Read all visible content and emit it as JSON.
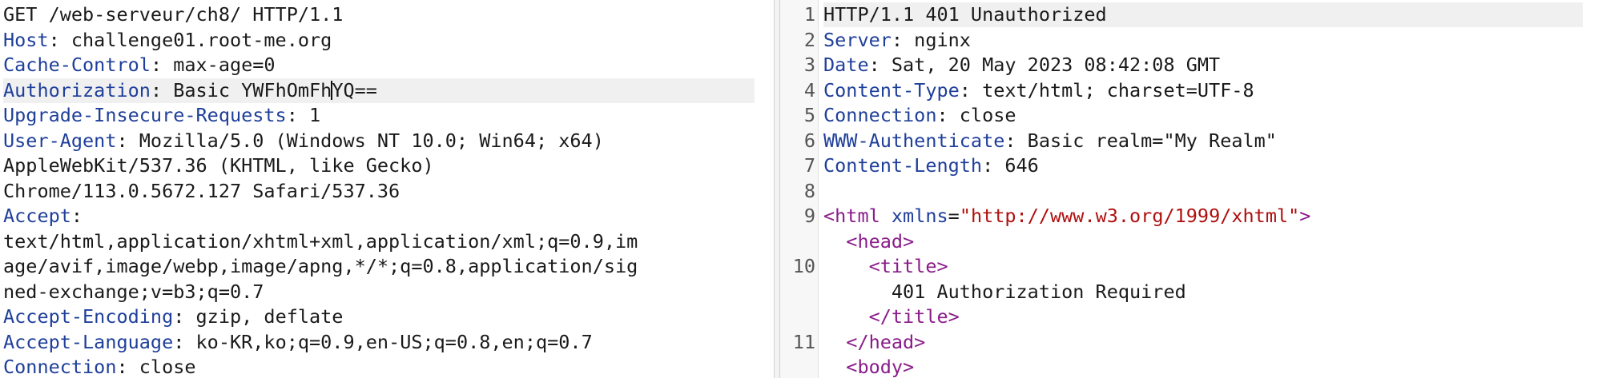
{
  "request": {
    "lines": [
      {
        "parts": [
          {
            "t": "plain",
            "v": "GET /web-serveur/ch8/ HTTP/1.1"
          }
        ]
      },
      {
        "parts": [
          {
            "t": "hname",
            "v": "Host"
          },
          {
            "t": "plain",
            "v": ": challenge01.root-me.org"
          }
        ]
      },
      {
        "parts": [
          {
            "t": "hname",
            "v": "Cache-Control"
          },
          {
            "t": "plain",
            "v": ": max-age=0"
          }
        ]
      },
      {
        "parts": [
          {
            "t": "hname",
            "v": "Authorization"
          },
          {
            "t": "plain",
            "v": ": Basic YWFhOmFh"
          },
          {
            "t": "caret",
            "v": ""
          },
          {
            "t": "plain",
            "v": "YQ=="
          }
        ],
        "highlight": true
      },
      {
        "parts": [
          {
            "t": "hname",
            "v": "Upgrade-Insecure-Requests"
          },
          {
            "t": "plain",
            "v": ": 1"
          }
        ]
      },
      {
        "parts": [
          {
            "t": "hname",
            "v": "User-Agent"
          },
          {
            "t": "plain",
            "v": ": Mozilla/5.0 (Windows NT 10.0; Win64; x64)"
          }
        ]
      },
      {
        "parts": [
          {
            "t": "plain",
            "v": "AppleWebKit/537.36 (KHTML, like Gecko)"
          }
        ]
      },
      {
        "parts": [
          {
            "t": "plain",
            "v": "Chrome/113.0.5672.127 Safari/537.36"
          }
        ]
      },
      {
        "parts": [
          {
            "t": "hname",
            "v": "Accept"
          },
          {
            "t": "plain",
            "v": ":"
          }
        ]
      },
      {
        "parts": [
          {
            "t": "plain",
            "v": "text/html,application/xhtml+xml,application/xml;q=0.9,im"
          }
        ]
      },
      {
        "parts": [
          {
            "t": "plain",
            "v": "age/avif,image/webp,image/apng,*/*;q=0.8,application/sig"
          }
        ]
      },
      {
        "parts": [
          {
            "t": "plain",
            "v": "ned-exchange;v=b3;q=0.7"
          }
        ]
      },
      {
        "parts": [
          {
            "t": "hname",
            "v": "Accept-Encoding"
          },
          {
            "t": "plain",
            "v": ": gzip, deflate"
          }
        ]
      },
      {
        "parts": [
          {
            "t": "hname",
            "v": "Accept-Language"
          },
          {
            "t": "plain",
            "v": ": ko-KR,ko;q=0.9,en-US;q=0.8,en;q=0.7"
          }
        ]
      },
      {
        "parts": [
          {
            "t": "hname",
            "v": "Connection"
          },
          {
            "t": "plain",
            "v": ": close"
          }
        ]
      }
    ]
  },
  "response": {
    "lines": [
      {
        "num": "1",
        "parts": [
          {
            "t": "plain",
            "v": "HTTP/1.1 401 Unauthorized"
          }
        ],
        "highlight": true
      },
      {
        "num": "2",
        "parts": [
          {
            "t": "hname",
            "v": "Server"
          },
          {
            "t": "plain",
            "v": ": nginx"
          }
        ]
      },
      {
        "num": "3",
        "parts": [
          {
            "t": "hname",
            "v": "Date"
          },
          {
            "t": "plain",
            "v": ": Sat, 20 May 2023 08:42:08 GMT"
          }
        ]
      },
      {
        "num": "4",
        "parts": [
          {
            "t": "hname",
            "v": "Content-Type"
          },
          {
            "t": "plain",
            "v": ": text/html; charset=UTF-8"
          }
        ]
      },
      {
        "num": "5",
        "parts": [
          {
            "t": "hname",
            "v": "Connection"
          },
          {
            "t": "plain",
            "v": ": close"
          }
        ]
      },
      {
        "num": "6",
        "parts": [
          {
            "t": "hname",
            "v": "WWW-Authenticate"
          },
          {
            "t": "plain",
            "v": ": Basic realm=\"My Realm\""
          }
        ]
      },
      {
        "num": "7",
        "parts": [
          {
            "t": "hname",
            "v": "Content-Length"
          },
          {
            "t": "plain",
            "v": ": 646"
          }
        ]
      },
      {
        "num": "8",
        "parts": []
      },
      {
        "num": "9",
        "parts": [
          {
            "t": "tag",
            "v": "<html"
          },
          {
            "t": "plain",
            "v": " "
          },
          {
            "t": "attr",
            "v": "xmlns"
          },
          {
            "t": "plain",
            "v": "="
          },
          {
            "t": "str",
            "v": "\"http://www.w3.org/1999/xhtml\""
          },
          {
            "t": "tag",
            "v": ">"
          }
        ]
      },
      {
        "num": "",
        "parts": [
          {
            "t": "plain",
            "v": "  "
          },
          {
            "t": "tag",
            "v": "<head>"
          }
        ]
      },
      {
        "num": "10",
        "parts": [
          {
            "t": "plain",
            "v": "    "
          },
          {
            "t": "tag",
            "v": "<title>"
          }
        ]
      },
      {
        "num": "",
        "parts": [
          {
            "t": "plain",
            "v": "      401 Authorization Required"
          }
        ]
      },
      {
        "num": "",
        "parts": [
          {
            "t": "plain",
            "v": "    "
          },
          {
            "t": "tag",
            "v": "</title>"
          }
        ]
      },
      {
        "num": "11",
        "parts": [
          {
            "t": "plain",
            "v": "  "
          },
          {
            "t": "tag",
            "v": "</head>"
          }
        ]
      },
      {
        "num": "",
        "parts": [
          {
            "t": "plain",
            "v": "  "
          },
          {
            "t": "tag",
            "v": "<body>"
          }
        ]
      }
    ]
  },
  "colors": {
    "header_name": "#1f3f9a",
    "tag": "#8a1c8a",
    "string": "#b01010",
    "tab_accent": "#e8763a"
  }
}
